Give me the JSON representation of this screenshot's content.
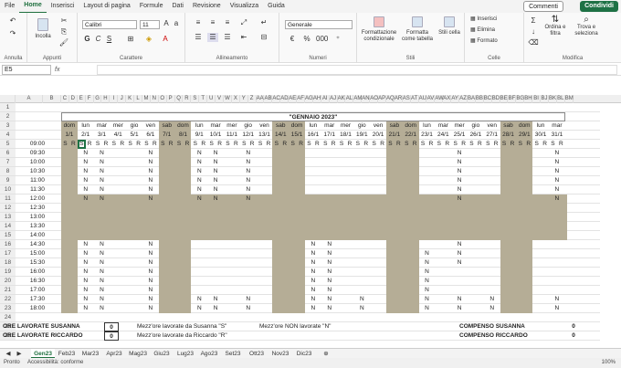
{
  "menu": [
    "File",
    "Home",
    "Inserisci",
    "Layout di pagina",
    "Formule",
    "Dati",
    "Revisione",
    "Visualizza",
    "Guida"
  ],
  "menu_active": 1,
  "comments_label": "Commenti",
  "share_label": "Condividi",
  "ribbon": {
    "annulla": "Annulla",
    "appunti": "Appunti",
    "incolla": "Incolla",
    "font_name": "Calibri",
    "font_size": "11",
    "carattere": "Carattere",
    "allineamento": "Allineamento",
    "numeri": "Numeri",
    "number_format": "Generale",
    "stili": "Stili",
    "cond_format": "Formattazione condizionale",
    "format_table": "Formatta come tabella",
    "cell_styles": "Stili cella",
    "celle": "Celle",
    "inserisci": "Inserisci",
    "elimina": "Elimina",
    "formato": "Formato",
    "modifica": "Modifica",
    "ordina": "Ordina e filtra",
    "trova": "Trova e seleziona",
    "bold": "G",
    "italic": "C",
    "underline": "S"
  },
  "namebox": "E5",
  "fx": "fx",
  "columns": [
    "A",
    "B",
    "C",
    "D",
    "E",
    "F",
    "G",
    "H",
    "I",
    "J",
    "K",
    "L",
    "M",
    "N",
    "O",
    "P",
    "Q",
    "R",
    "S",
    "T",
    "U",
    "V",
    "W",
    "X",
    "Y",
    "Z",
    "AA",
    "AB",
    "AC",
    "AD",
    "AE",
    "AF",
    "AG",
    "AH",
    "AI",
    "AJ",
    "AK",
    "AL",
    "AM",
    "AN",
    "AO",
    "AP",
    "AQ",
    "AR",
    "AS",
    "AT",
    "AU",
    "AV",
    "AW",
    "AX",
    "AY",
    "AZ",
    "BA",
    "BB",
    "BC",
    "BD",
    "BE",
    "BF",
    "BG",
    "BH",
    "BI",
    "BJ",
    "BK",
    "BL",
    "BM"
  ],
  "title": "\"GENNAIO  2023\"",
  "days": [
    "dom",
    "lun",
    "mar",
    "mer",
    "gio",
    "ven",
    "sab",
    "dom",
    "lun",
    "mar",
    "mer",
    "gio",
    "ven",
    "sab",
    "dom",
    "lun",
    "mar",
    "mer",
    "gio",
    "ven",
    "sab",
    "dom",
    "lun",
    "mar",
    "mer",
    "gio",
    "ven",
    "sab",
    "dom",
    "lun",
    "mar"
  ],
  "dates": [
    "1/1",
    "2/1",
    "3/1",
    "4/1",
    "5/1",
    "6/1",
    "7/1",
    "8/1",
    "9/1",
    "10/1",
    "11/1",
    "12/1",
    "13/1",
    "14/1",
    "15/1",
    "16/1",
    "17/1",
    "18/1",
    "19/1",
    "20/1",
    "21/1",
    "22/1",
    "23/1",
    "24/1",
    "25/1",
    "26/1",
    "27/1",
    "28/1",
    "29/1",
    "30/1",
    "31/1"
  ],
  "sr": [
    "S",
    "R"
  ],
  "times": [
    "09:00",
    "09:30",
    "10:00",
    "10:30",
    "11:00",
    "11:30",
    "12:00",
    "12:30",
    "13:00",
    "13:30",
    "14:00",
    "14:30",
    "15:00",
    "15:30",
    "16:00",
    "16:30",
    "17:00",
    "17:30",
    "18:00"
  ],
  "n": "N",
  "summary": {
    "ore_susanna": "ORE LAVORATE SUSANNA",
    "ore_susanna_val": "0",
    "ore_riccardo": "ORE LAVORATE RICCARDO",
    "ore_riccardo_val": "0",
    "legend_s": "Mezz'ore lavorate da Susanna \"S\"",
    "legend_r": "Mezz'ore lavorate da Riccardo \"R\"",
    "legend_n": "Mezz'ore NON lavorate \"N\"",
    "comp_susanna": "COMPENSO SUSANNA",
    "comp_susanna_val": "0",
    "comp_riccardo": "COMPENSO RICCARDO",
    "comp_riccardo_val": "0"
  },
  "sheets": [
    "Gen23",
    "Feb23",
    "Mar23",
    "Apr23",
    "Mag23",
    "Giu23",
    "Lug23",
    "Ago23",
    "Set23",
    "Ott23",
    "Nov23",
    "Dic23"
  ],
  "sheet_active": 0,
  "status": {
    "ready": "Pronto",
    "access": "Accessibilità: conforme",
    "zoom": "100%"
  }
}
